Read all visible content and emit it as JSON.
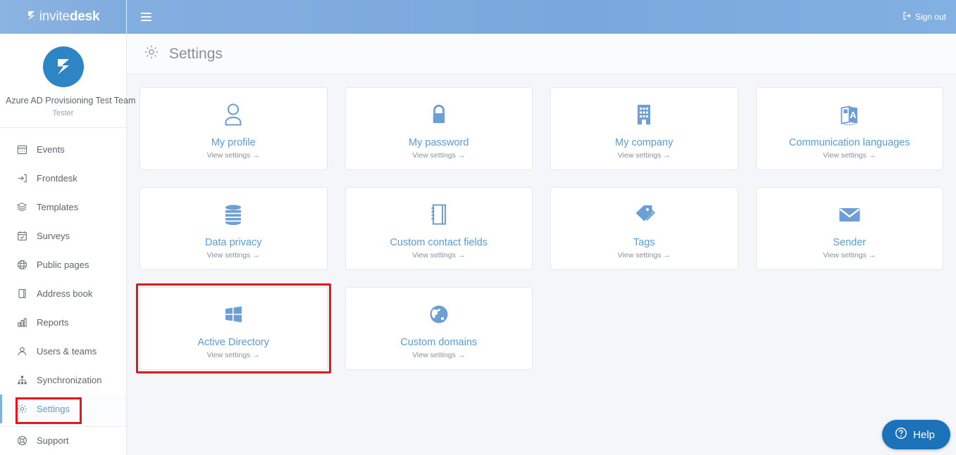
{
  "brand": {
    "light": "invite",
    "bold": "desk",
    "logo_icon": "invitedesk-logo-icon"
  },
  "topbar": {
    "menu_icon": "hamburger-menu-icon",
    "signout_label": "Sign out",
    "signout_icon": "sign-out-icon"
  },
  "sidebar": {
    "profile": {
      "team_name": "Azure AD Provisioning Test Team",
      "role": "Tester",
      "avatar_icon": "team-avatar-icon"
    },
    "items": [
      {
        "label": "Events",
        "icon": "calendar-icon",
        "active": false
      },
      {
        "label": "Frontdesk",
        "icon": "login-arrow-icon",
        "active": false
      },
      {
        "label": "Templates",
        "icon": "layers-icon",
        "active": false
      },
      {
        "label": "Surveys",
        "icon": "calendar-check-icon",
        "active": false
      },
      {
        "label": "Public pages",
        "icon": "globe-icon",
        "active": false
      },
      {
        "label": "Address book",
        "icon": "book-icon",
        "active": false
      },
      {
        "label": "Reports",
        "icon": "bar-chart-icon",
        "active": false
      },
      {
        "label": "Users & teams",
        "icon": "users-icon",
        "active": false
      },
      {
        "label": "Synchronization",
        "icon": "sitemap-icon",
        "active": false
      },
      {
        "label": "Settings",
        "icon": "gear-icon",
        "active": true
      },
      {
        "label": "Support",
        "icon": "lifebuoy-icon",
        "active": false
      }
    ]
  },
  "page": {
    "title": "Settings",
    "icon": "gear-icon"
  },
  "cards": [
    {
      "title": "My profile",
      "link": "View settings →",
      "icon": "user-icon"
    },
    {
      "title": "My password",
      "link": "View settings →",
      "icon": "lock-icon"
    },
    {
      "title": "My company",
      "link": "View settings →",
      "icon": "building-icon"
    },
    {
      "title": "Communication languages",
      "link": "View settings →",
      "icon": "language-icon"
    },
    {
      "title": "Data privacy",
      "link": "View settings →",
      "icon": "database-icon"
    },
    {
      "title": "Custom contact fields",
      "link": "View settings →",
      "icon": "notebook-icon"
    },
    {
      "title": "Tags",
      "link": "View settings →",
      "icon": "tags-icon"
    },
    {
      "title": "Sender",
      "link": "View settings →",
      "icon": "envelope-icon"
    },
    {
      "title": "Active Directory",
      "link": "View settings →",
      "icon": "windows-icon",
      "highlight": true
    },
    {
      "title": "Custom domains",
      "link": "View settings →",
      "icon": "globe-filled-icon"
    }
  ],
  "help": {
    "label": "Help",
    "icon": "question-circle-icon"
  },
  "colors": {
    "header_blue": "#83aee0",
    "accent_blue": "#5b9bd5",
    "icon_blue": "#6d9fd6",
    "highlight_red": "#e8161a",
    "help_blue": "#1b72b8",
    "content_bg": "#f4f6f9"
  }
}
